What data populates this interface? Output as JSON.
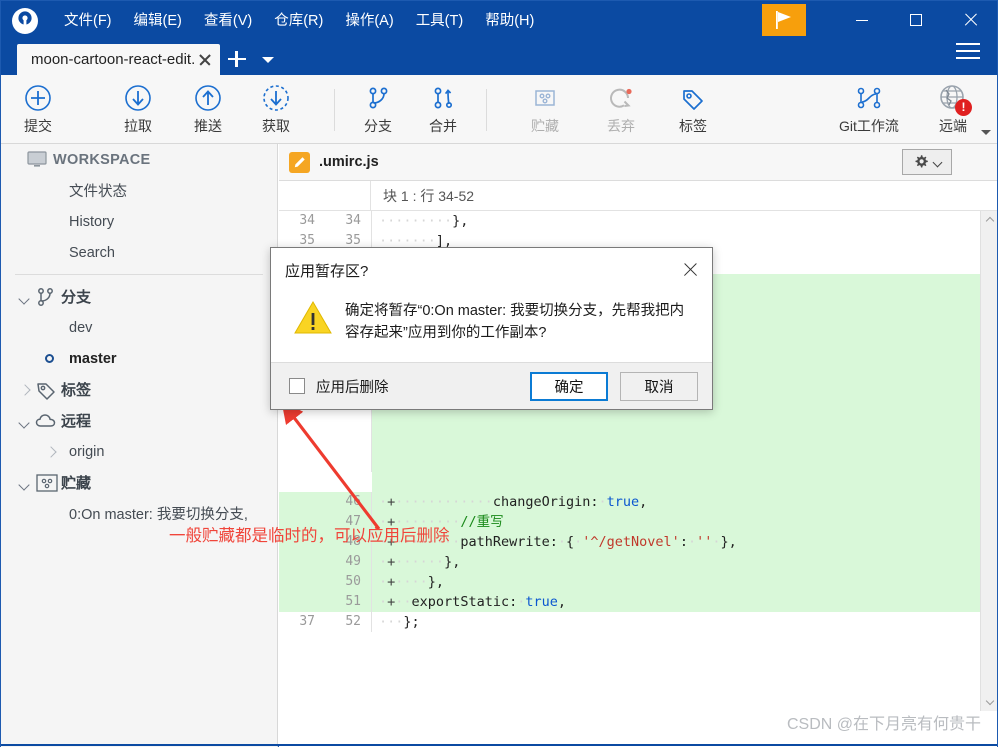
{
  "window": {
    "logo_icon": "sourcetree-logo-icon",
    "flag_button_icon": "flag-icon",
    "minimize_icon": "minimize-icon",
    "maximize_icon": "maximize-icon",
    "close_icon": "close-icon",
    "hamburger_icon": "hamburger-menu-icon"
  },
  "menu": {
    "items": [
      {
        "label": "文件(F)"
      },
      {
        "label": "编辑(E)"
      },
      {
        "label": "查看(V)"
      },
      {
        "label": "仓库(R)"
      },
      {
        "label": "操作(A)"
      },
      {
        "label": "工具(T)"
      },
      {
        "label": "帮助(H)"
      }
    ]
  },
  "tabs": {
    "active": "moon-cartoon-react-edit.",
    "close_icon": "close-icon",
    "new_tab_icon": "plus-icon",
    "tab_list_icon": "chevron-down-icon"
  },
  "toolbar": {
    "buttons": [
      {
        "label": "提交",
        "icon": "commit-plus-icon",
        "disabled": false
      },
      {
        "label": "拉取",
        "icon": "pull-down-arrow-icon",
        "disabled": false
      },
      {
        "label": "推送",
        "icon": "push-up-arrow-icon",
        "disabled": false
      },
      {
        "label": "获取",
        "icon": "fetch-dashed-arrow-icon",
        "disabled": false
      },
      {
        "label": "分支",
        "icon": "branch-icon",
        "disabled": false
      },
      {
        "label": "合并",
        "icon": "merge-icon",
        "disabled": false
      },
      {
        "label": "贮藏",
        "icon": "stash-icon",
        "disabled": true
      },
      {
        "label": "丢弃",
        "icon": "discard-reset-icon",
        "disabled": true
      },
      {
        "label": "标签",
        "icon": "tag-icon",
        "disabled": false
      },
      {
        "label": "Git工作流",
        "icon": "git-flow-icon",
        "disabled": false
      },
      {
        "label": "远端",
        "icon": "remote-globe-icon",
        "disabled": false
      }
    ],
    "remote_badge": "!",
    "overflow_icon": "chevron-down-icon"
  },
  "sidebar": {
    "workspace": {
      "label": "WORKSPACE",
      "icon": "monitor-icon",
      "items": [
        {
          "label": "文件状态"
        },
        {
          "label": "History"
        },
        {
          "label": "Search"
        }
      ]
    },
    "groups": [
      {
        "label": "分支",
        "icon": "branch-icon",
        "expanded": true,
        "items": [
          {
            "label": "dev",
            "current": false
          },
          {
            "label": "master",
            "current": true
          }
        ]
      },
      {
        "label": "标签",
        "icon": "tag-icon",
        "expanded": false,
        "items": []
      },
      {
        "label": "远程",
        "icon": "cloud-icon",
        "expanded": true,
        "items": [
          {
            "label": "origin",
            "child_expandable": true
          }
        ]
      },
      {
        "label": "贮藏",
        "icon": "stash-icon",
        "expanded": true,
        "items": [
          {
            "label": "0:On master: 我要切换分支,"
          }
        ]
      }
    ]
  },
  "main": {
    "file": {
      "name": ".umirc.js",
      "icon": "edit-pencil-icon"
    },
    "settings_button": {
      "icon": "gear-icon",
      "caret_icon": "chevron-down-icon"
    },
    "hunk_title": "块 1 :  行 34-52",
    "code_lines": [
      {
        "old": "34",
        "new": "34",
        "marker": "",
        "text": "·········},",
        "added": false
      },
      {
        "old": "35",
        "new": "35",
        "marker": "",
        "text": "·······],",
        "added": false
      },
      {
        "old": "",
        "new": "46",
        "marker": "+",
        "text": "············changeOrigin:·true,",
        "added": true
      },
      {
        "old": "",
        "new": "47",
        "marker": "+",
        "text": "········//重写",
        "added": true
      },
      {
        "old": "",
        "new": "48",
        "marker": "+",
        "text": "········pathRewrite:·{·'^/getNovel':·''·},",
        "added": true
      },
      {
        "old": "",
        "new": "49",
        "marker": "+",
        "text": "······},",
        "added": true
      },
      {
        "old": "",
        "new": "50",
        "marker": "+",
        "text": "····},",
        "added": true
      },
      {
        "old": "",
        "new": "51",
        "marker": "+",
        "text": "··exportStatic:·true,",
        "added": true
      },
      {
        "old": "37",
        "new": "52",
        "marker": "",
        "text": "···};",
        "added": false
      }
    ],
    "scroll_up_icon": "chevron-up-icon",
    "scroll_down_icon": "chevron-down-icon"
  },
  "dialog": {
    "title": "应用暂存区?",
    "close_icon": "close-icon",
    "warning_icon": "warning-triangle-icon",
    "message": "确定将暂存“0:On master: 我要切换分支，先帮我把内容存起来”应用到你的工作副本?",
    "checkbox": {
      "label": "应用后删除",
      "checked": false
    },
    "confirm_label": "确定",
    "cancel_label": "取消"
  },
  "annotations": {
    "note_text": "一般贮藏都是临时的，可以应用后删除",
    "arrow_icon": "red-arrow-icon",
    "color": "#f0453a"
  },
  "watermark": {
    "text": "CSDN @在下月亮有何贵干"
  },
  "colors": {
    "titlebar": "#0b4aa2",
    "accent_orange": "#f79f0c",
    "toolbar_icon_blue": "#1c6fd0",
    "diff_add_bg": "#d9f8d9",
    "badge_red": "#e02020",
    "annotation_red": "#f0453a"
  }
}
